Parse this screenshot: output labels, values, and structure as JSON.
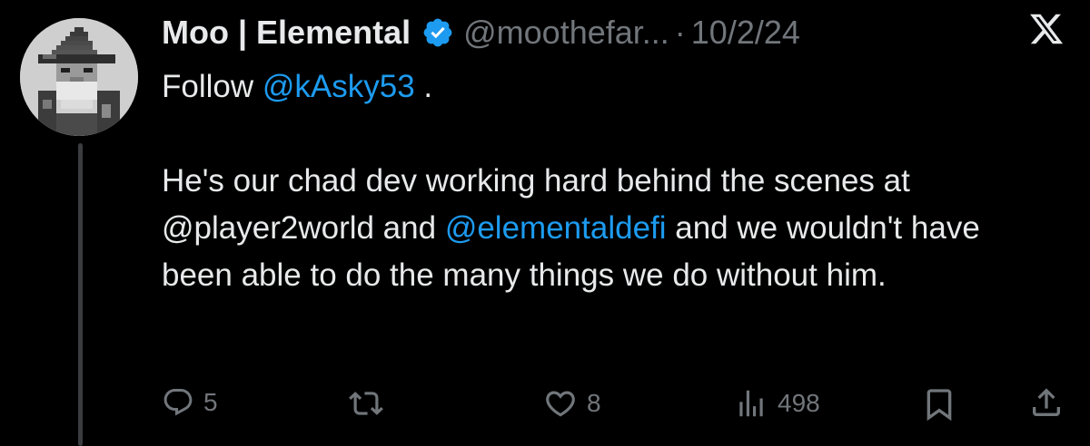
{
  "tweet": {
    "author": {
      "display_name": "Moo | Elemental",
      "handle": "@moothefar...",
      "verified": true
    },
    "separator": "·",
    "date": "10/2/24",
    "body": {
      "line1_prefix": "Follow ",
      "line1_mention": "@kAsky53",
      "line1_suffix": " .",
      "para2_part1": "He's our chad dev working hard behind the scenes at @player2world and ",
      "para2_mention": "@elementaldefi",
      "para2_part2": " and we wouldn't have been able to do the many things we do without him."
    },
    "actions": {
      "replies": "5",
      "likes": "8",
      "views": "498"
    }
  },
  "icons": {
    "logo": "x-logo-icon",
    "verified": "verified-badge-icon",
    "reply": "reply-icon",
    "retweet": "retweet-icon",
    "like": "heart-icon",
    "views": "views-chart-icon",
    "bookmark": "bookmark-icon",
    "share": "share-icon"
  },
  "colors": {
    "background": "#000000",
    "text": "#e7e9ea",
    "muted": "#71767b",
    "link": "#1d9bf0"
  }
}
